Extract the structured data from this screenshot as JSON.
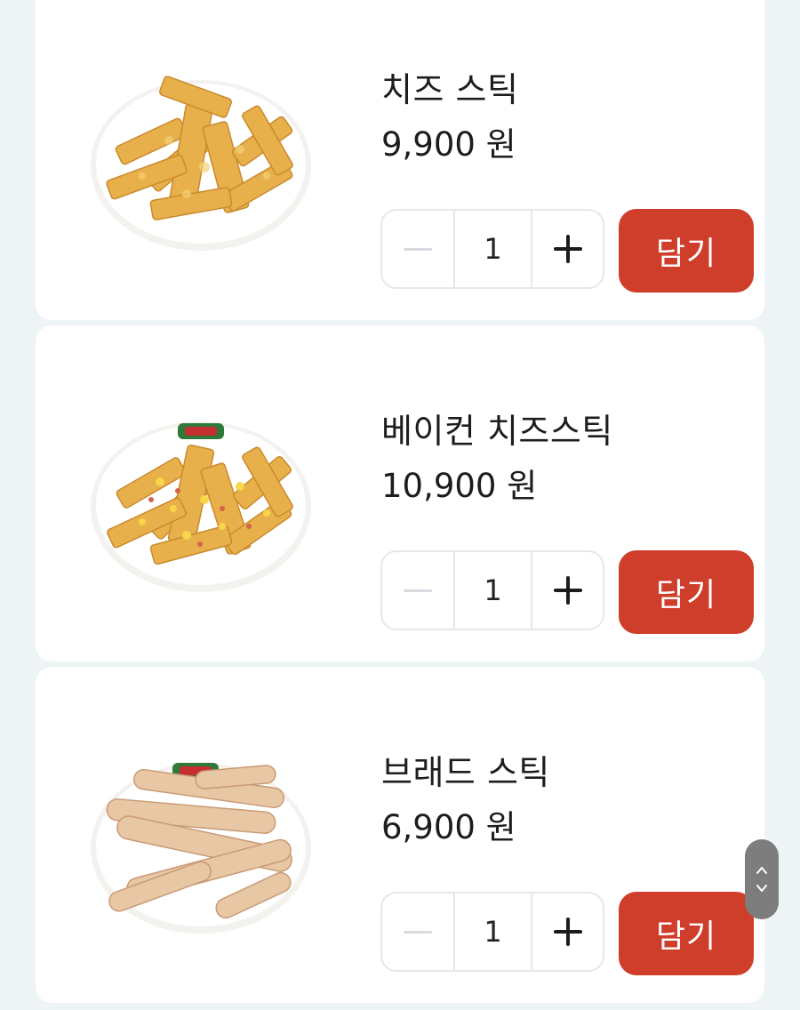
{
  "products": [
    {
      "name": "치즈 스틱",
      "price": "9,900 원",
      "quantity": "1",
      "add_label": "담기",
      "image": "cheese-stick-plate"
    },
    {
      "name": "베이컨 치즈스틱",
      "price": "10,900 원",
      "quantity": "1",
      "add_label": "담기",
      "image": "bacon-cheese-stick-plate"
    },
    {
      "name": "브래드 스틱",
      "price": "6,900 원",
      "quantity": "1",
      "add_label": "담기",
      "image": "bread-stick-plate"
    }
  ],
  "colors": {
    "accent": "#cf3d2b",
    "background": "#eef3f6",
    "card": "#ffffff",
    "stepper_border": "#e4e8ec"
  },
  "icons": {
    "minus": "minus-icon",
    "plus": "plus-icon",
    "scroll_up": "chevron-up-icon",
    "scroll_down": "chevron-down-icon"
  }
}
